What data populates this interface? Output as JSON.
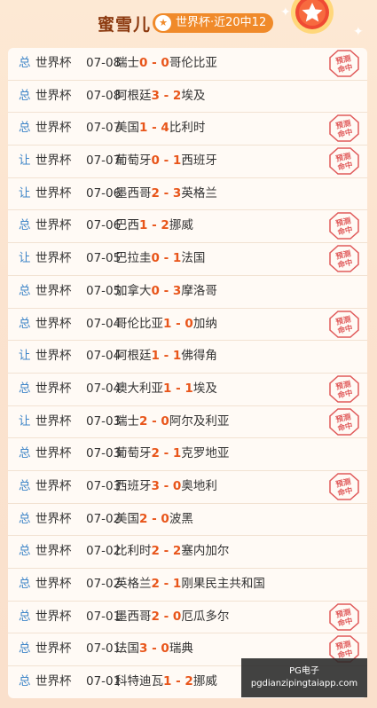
{
  "header": {
    "name": "蜜雪儿",
    "badge": "世界杯·近20中12"
  },
  "icons": {
    "pill_star": "star-icon",
    "medal": "medal-star-icon",
    "stamp": "预测命中-stamp-icon"
  },
  "colors": {
    "score": "#e8551a",
    "tag": "#3f86c8",
    "accent": "#f08a2a",
    "stamp": "#e05a5a"
  },
  "stamp_text": [
    "预测",
    "命中"
  ],
  "rows": [
    {
      "tag": "总",
      "comp": "世界杯",
      "date": "07-08",
      "home": "瑞士",
      "hs": "0",
      "as": "0",
      "away": "哥伦比亚",
      "hit": true
    },
    {
      "tag": "总",
      "comp": "世界杯",
      "date": "07-08",
      "home": "阿根廷",
      "hs": "3",
      "as": "2",
      "away": "埃及",
      "hit": false
    },
    {
      "tag": "总",
      "comp": "世界杯",
      "date": "07-07",
      "home": "美国",
      "hs": "1",
      "as": "4",
      "away": "比利时",
      "hit": true
    },
    {
      "tag": "让",
      "comp": "世界杯",
      "date": "07-07",
      "home": "葡萄牙",
      "hs": "0",
      "as": "1",
      "away": "西班牙",
      "hit": true
    },
    {
      "tag": "让",
      "comp": "世界杯",
      "date": "07-06",
      "home": "墨西哥",
      "hs": "2",
      "as": "3",
      "away": "英格兰",
      "hit": false
    },
    {
      "tag": "总",
      "comp": "世界杯",
      "date": "07-06",
      "home": "巴西",
      "hs": "1",
      "as": "2",
      "away": "挪威",
      "hit": true
    },
    {
      "tag": "让",
      "comp": "世界杯",
      "date": "07-05",
      "home": "巴拉圭",
      "hs": "0",
      "as": "1",
      "away": "法国",
      "hit": true
    },
    {
      "tag": "总",
      "comp": "世界杯",
      "date": "07-05",
      "home": "加拿大",
      "hs": "0",
      "as": "3",
      "away": "摩洛哥",
      "hit": false
    },
    {
      "tag": "总",
      "comp": "世界杯",
      "date": "07-04",
      "home": "哥伦比亚",
      "hs": "1",
      "as": "0",
      "away": "加纳",
      "hit": true
    },
    {
      "tag": "让",
      "comp": "世界杯",
      "date": "07-04",
      "home": "阿根廷",
      "hs": "1",
      "as": "1",
      "away": "佛得角",
      "hit": false
    },
    {
      "tag": "总",
      "comp": "世界杯",
      "date": "07-04",
      "home": "澳大利亚",
      "hs": "1",
      "as": "1",
      "away": "埃及",
      "hit": true
    },
    {
      "tag": "让",
      "comp": "世界杯",
      "date": "07-03",
      "home": "瑞士",
      "hs": "2",
      "as": "0",
      "away": "阿尔及利亚",
      "hit": true
    },
    {
      "tag": "总",
      "comp": "世界杯",
      "date": "07-03",
      "home": "葡萄牙",
      "hs": "2",
      "as": "1",
      "away": "克罗地亚",
      "hit": false
    },
    {
      "tag": "总",
      "comp": "世界杯",
      "date": "07-03",
      "home": "西班牙",
      "hs": "3",
      "as": "0",
      "away": "奥地利",
      "hit": true
    },
    {
      "tag": "总",
      "comp": "世界杯",
      "date": "07-02",
      "home": "美国",
      "hs": "2",
      "as": "0",
      "away": "波黑",
      "hit": false
    },
    {
      "tag": "总",
      "comp": "世界杯",
      "date": "07-02",
      "home": "比利时",
      "hs": "2",
      "as": "2",
      "away": "塞内加尔",
      "hit": false
    },
    {
      "tag": "总",
      "comp": "世界杯",
      "date": "07-02",
      "home": "英格兰",
      "hs": "2",
      "as": "1",
      "away": "刚果民主共和国",
      "hit": false
    },
    {
      "tag": "总",
      "comp": "世界杯",
      "date": "07-01",
      "home": "墨西哥",
      "hs": "2",
      "as": "0",
      "away": "厄瓜多尔",
      "hit": true
    },
    {
      "tag": "总",
      "comp": "世界杯",
      "date": "07-01",
      "home": "法国",
      "hs": "3",
      "as": "0",
      "away": "瑞典",
      "hit": true
    },
    {
      "tag": "总",
      "comp": "世界杯",
      "date": "07-01",
      "home": "科特迪瓦",
      "hs": "1",
      "as": "2",
      "away": "挪威",
      "hit": false
    }
  ],
  "watermark": {
    "line1": "PG电子",
    "line2": "pgdianzipingtaiapp.com"
  }
}
